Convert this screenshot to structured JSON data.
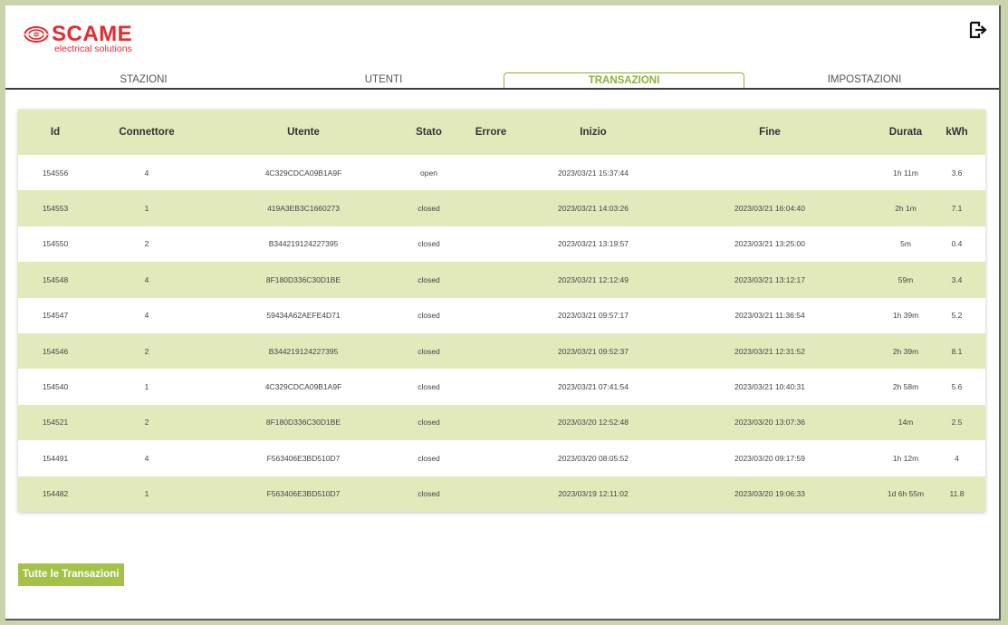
{
  "brand": {
    "name": "SCAME",
    "tagline": "electrical solutions",
    "color": "#e8292e"
  },
  "header": {
    "logout_icon": "logout-icon"
  },
  "tabs": [
    {
      "label": "STAZIONI",
      "active": false
    },
    {
      "label": "UTENTI",
      "active": false
    },
    {
      "label": "TRANSAZIONI",
      "active": true
    },
    {
      "label": "IMPOSTAZIONI",
      "active": false
    }
  ],
  "accent_color": "#8db03d",
  "table": {
    "columns": [
      "Id",
      "Connettore",
      "Utente",
      "Stato",
      "Errore",
      "Inizio",
      "Fine",
      "Durata",
      "kWh"
    ],
    "rows": [
      [
        "154556",
        "4",
        "4C329CDCA09B1A9F",
        "open",
        "",
        "2023/03/21 15:37:44",
        "",
        "1h 11m",
        "3.6"
      ],
      [
        "154553",
        "1",
        "419A3EB3C1660273",
        "closed",
        "",
        "2023/03/21 14:03:26",
        "2023/03/21 16:04:40",
        "2h 1m",
        "7.1"
      ],
      [
        "154550",
        "2",
        "B344219124227395",
        "closed",
        "",
        "2023/03/21 13:19:57",
        "2023/03/21 13:25:00",
        "5m",
        "0.4"
      ],
      [
        "154548",
        "4",
        "8F180D336C30D1BE",
        "closed",
        "",
        "2023/03/21 12:12:49",
        "2023/03/21 13:12:17",
        "59m",
        "3.4"
      ],
      [
        "154547",
        "4",
        "59434A62AEFE4D71",
        "closed",
        "",
        "2023/03/21 09:57:17",
        "2023/03/21 11:36:54",
        "1h 39m",
        "5.2"
      ],
      [
        "154546",
        "2",
        "B344219124227395",
        "closed",
        "",
        "2023/03/21 09:52:37",
        "2023/03/21 12:31:52",
        "2h 39m",
        "8.1"
      ],
      [
        "154540",
        "1",
        "4C329CDCA09B1A9F",
        "closed",
        "",
        "2023/03/21 07:41:54",
        "2023/03/21 10:40:31",
        "2h 58m",
        "5.6"
      ],
      [
        "154521",
        "2",
        "8F180D336C30D1BE",
        "closed",
        "",
        "2023/03/20 12:52:48",
        "2023/03/20 13:07:36",
        "14m",
        "2.5"
      ],
      [
        "154491",
        "4",
        "F563406E3BD510D7",
        "closed",
        "",
        "2023/03/20 08:05:52",
        "2023/03/20 09:17:59",
        "1h 12m",
        "4"
      ],
      [
        "154482",
        "1",
        "F563406E3BD510D7",
        "closed",
        "",
        "2023/03/19 12:11:02",
        "2023/03/20 19:06:33",
        "1d 6h 55m",
        "11.8"
      ]
    ]
  },
  "footer": {
    "all_transactions_label": "Tutte le Transazioni"
  }
}
